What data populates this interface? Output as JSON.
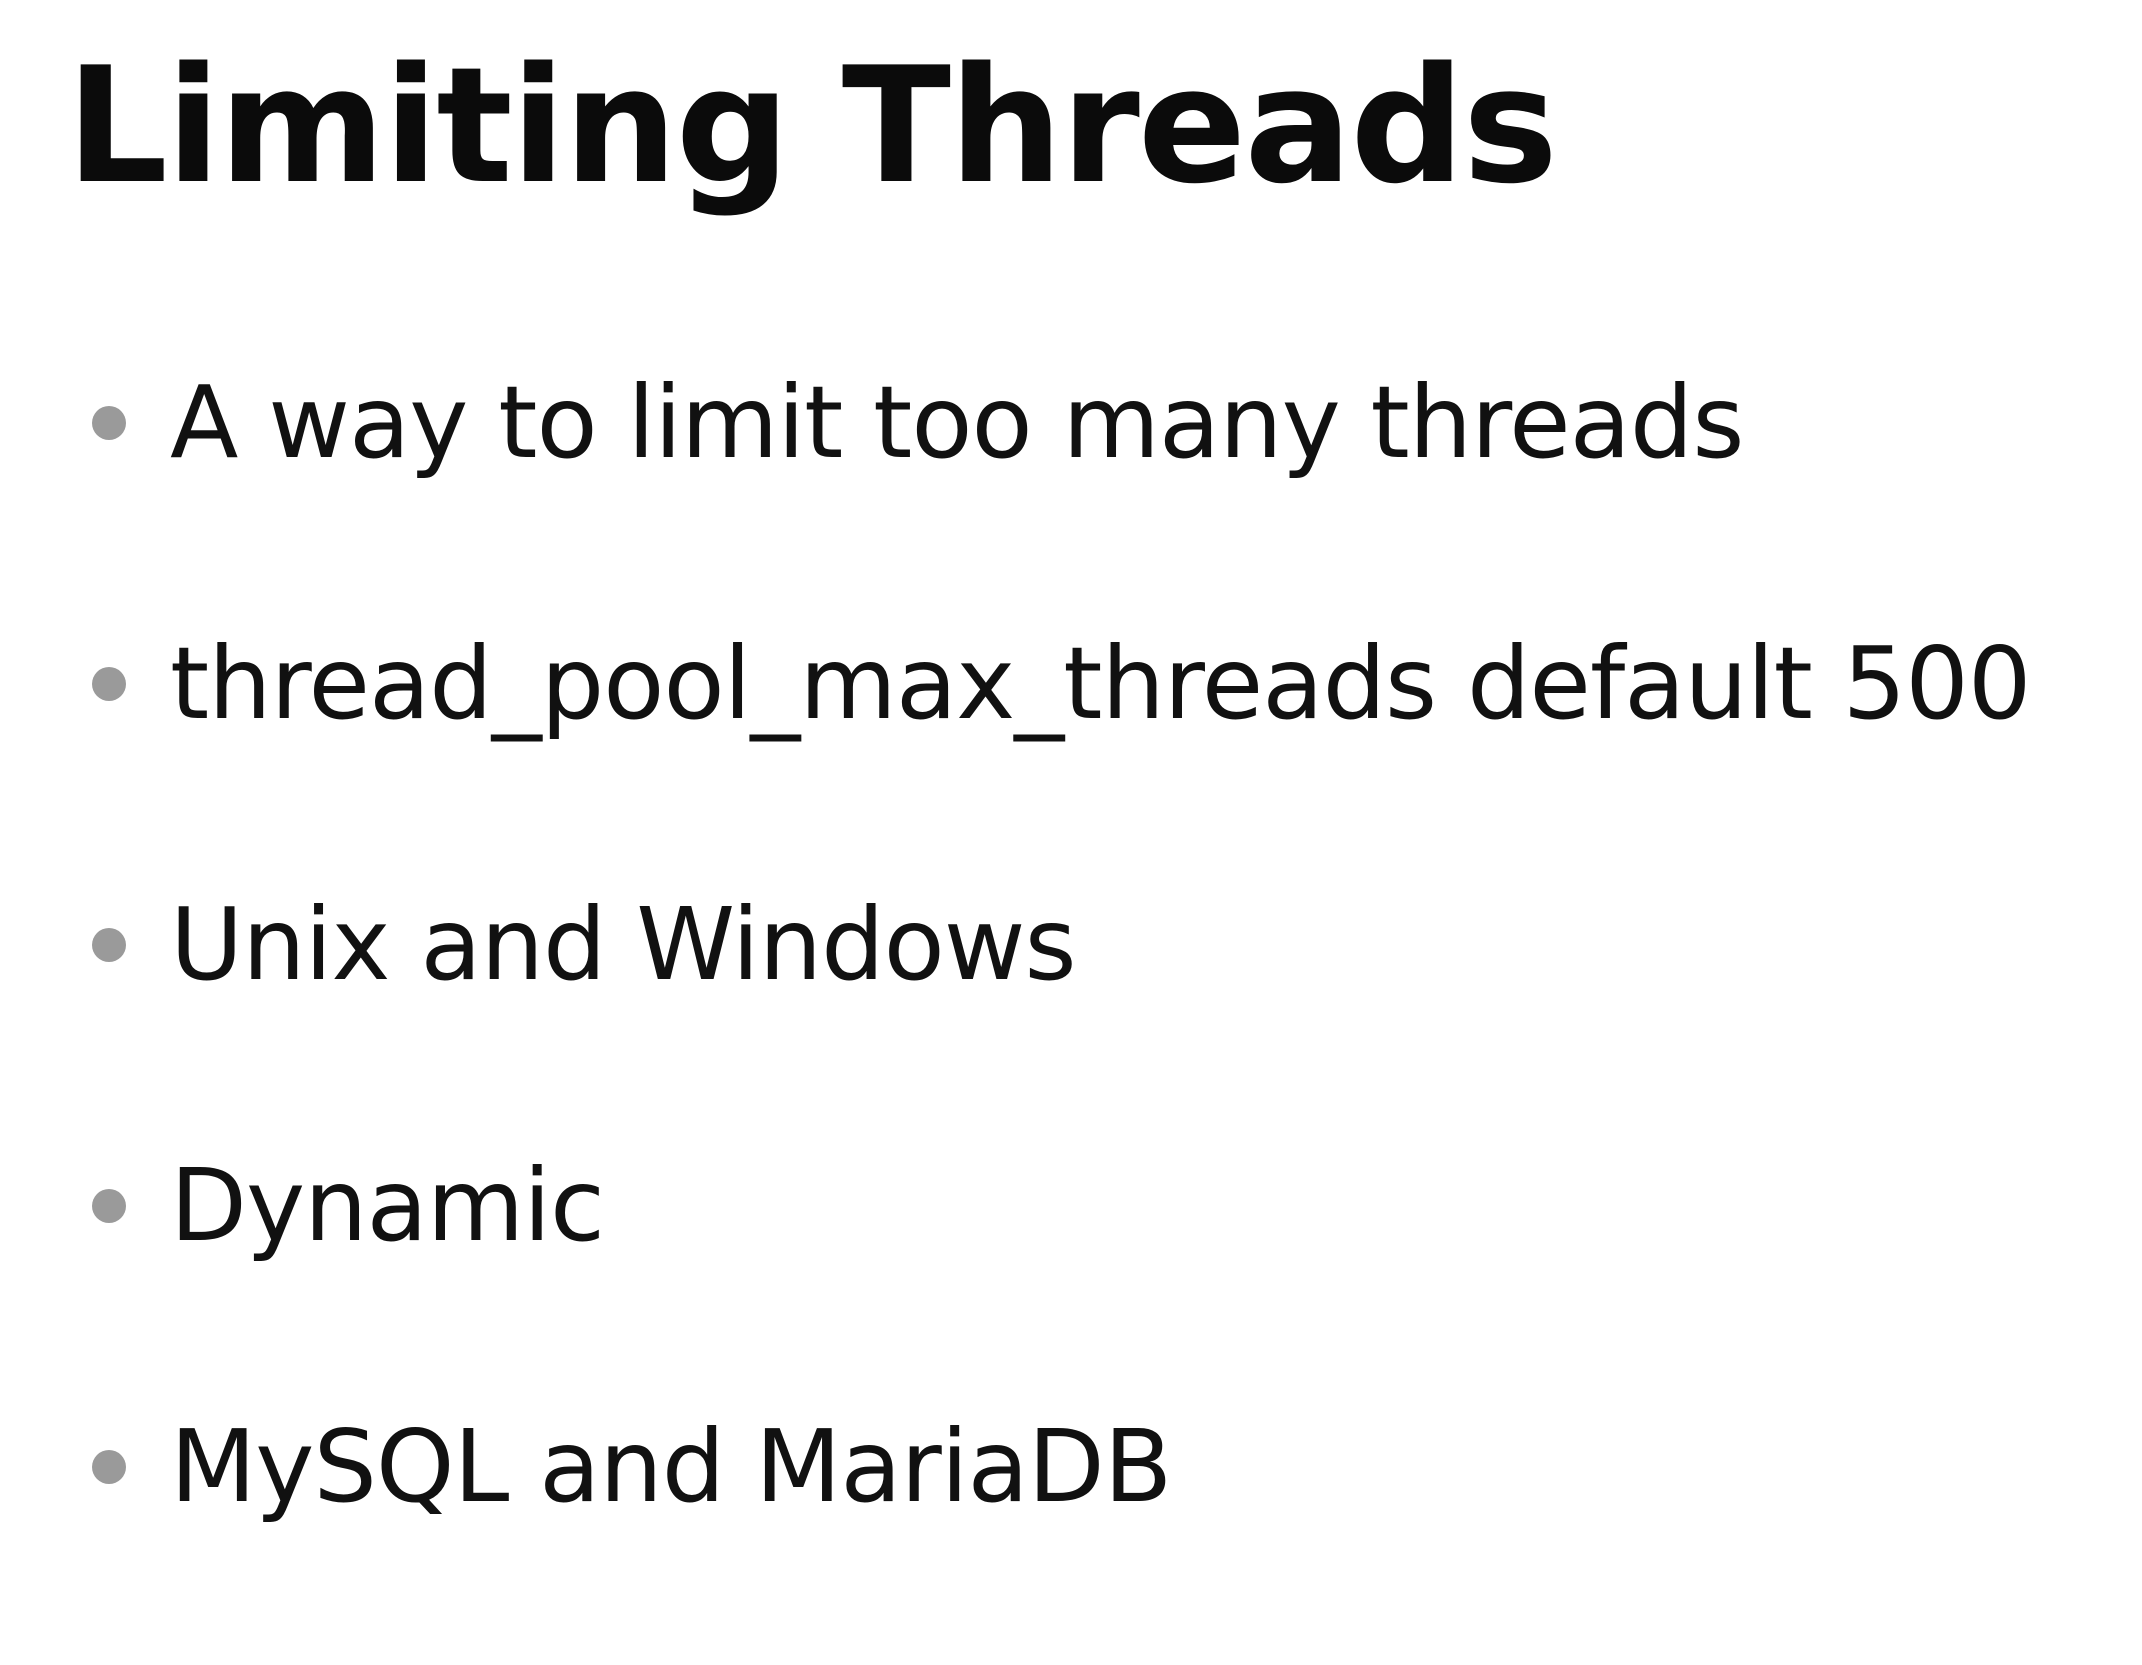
{
  "slide": {
    "title": "Limiting Threads",
    "bullets": [
      "A way to limit too many threads",
      "thread_pool_max_threads default 500",
      "Unix and Windows",
      "Dynamic",
      "MySQL and MariaDB"
    ],
    "colors": {
      "text": "#111111",
      "bullet": "#9a9a9a",
      "background": "#ffffff"
    },
    "icons": {
      "bullet": "bullet-dot-icon"
    }
  }
}
